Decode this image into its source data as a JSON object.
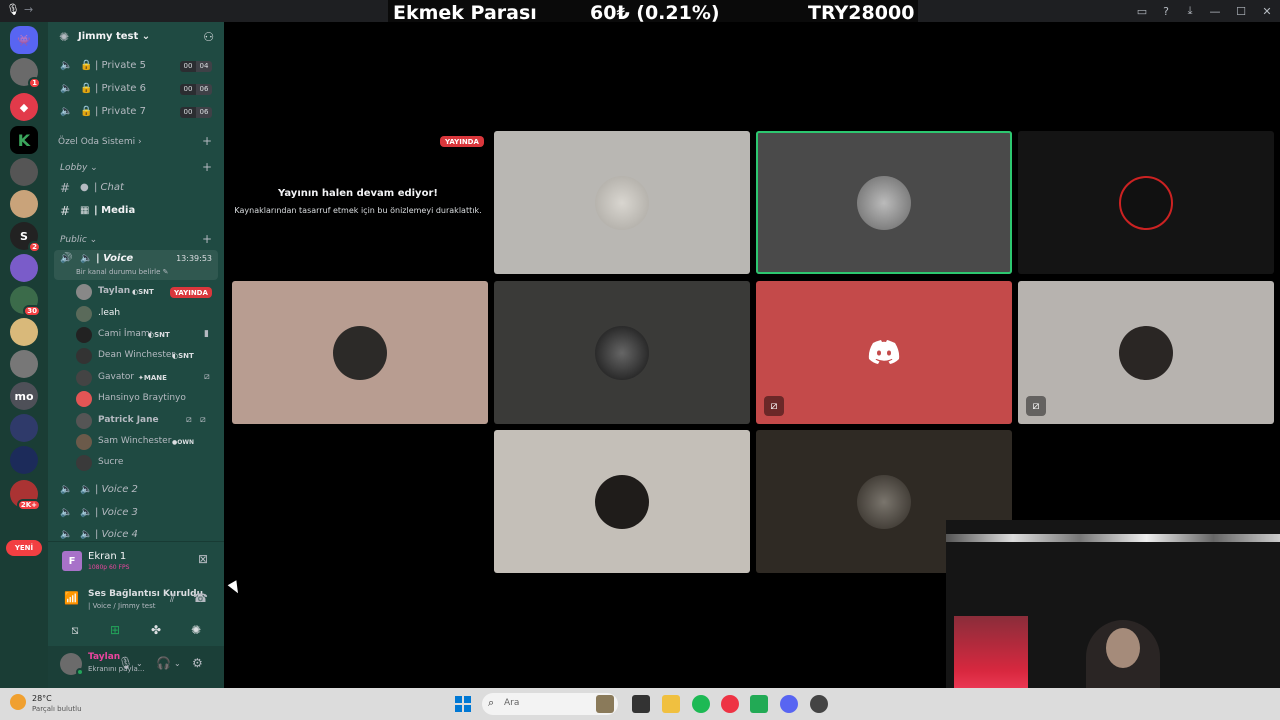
{
  "ticker": {
    "name": "Ekmek Parası",
    "change": "60₺ (0.21%)",
    "total": "TRY28000"
  },
  "guilds": {
    "badge_1": "1",
    "badge_2": "2",
    "badge_30": "30",
    "label_mo": "mo",
    "badge_2k": "2K+",
    "new_label": "YENİ"
  },
  "server": {
    "name": "Jimmy test"
  },
  "channels": {
    "private5": "| Private 5",
    "private6": "| Private 6",
    "private7": "| Private 7",
    "p5_counts": [
      "00",
      "04"
    ],
    "p6_counts": [
      "00",
      "06"
    ],
    "p7_counts": [
      "00",
      "06"
    ],
    "cat_ozel": "Özel Oda Sistemi",
    "cat_lobby": "Lobby",
    "chat": "| Chat",
    "media": "| Media",
    "cat_public": "Public",
    "voice": "| Voice",
    "voice_time": "13:39:53",
    "voice_status": "Bir kanal durumu belirle",
    "voice2": "| Voice 2",
    "voice3": "| Voice 3",
    "voice4": "| Voice 4"
  },
  "members": [
    {
      "name": "Taylan",
      "tag": "SNT",
      "live": "YAYINDA"
    },
    {
      "name": ".leah",
      "tag": "",
      "live": ""
    },
    {
      "name": "Cami İmamı",
      "tag": "SNT",
      "live": ""
    },
    {
      "name": "Dean Winchester",
      "tag": "SNT",
      "live": ""
    },
    {
      "name": "Gavator",
      "tag": "MANE",
      "live": ""
    },
    {
      "name": "Hansinyo Braytinyo",
      "tag": "",
      "live": ""
    },
    {
      "name": "Patrick Jane",
      "tag": "",
      "live": ""
    },
    {
      "name": "Sam Winchester",
      "tag": "OWN",
      "live": ""
    },
    {
      "name": "Sucre",
      "tag": "",
      "live": ""
    }
  ],
  "stream_panel": {
    "title": "Ekran 1",
    "quality": "1080p 60 FPS",
    "avatar_letter": "F"
  },
  "connection": {
    "title": "Ses Bağlantısı Kuruldu",
    "subtitle": "| Voice / Jimmy test"
  },
  "user": {
    "name": "Taylan",
    "status": "Ekranını payla..."
  },
  "stage": {
    "live_badge": "YAYINDA",
    "title": "Yayının halen devam ediyor!",
    "subtitle": "Kaynaklarından tasarruf etmek için bu önizlemeyi duraklattık."
  },
  "taskbar": {
    "temp": "28°C",
    "weather": "Parçalı bulutlu",
    "weather_badge": "1",
    "search_placeholder": "Ara"
  },
  "colors": {
    "accent_live": "#da373c",
    "speaking": "#2dc770",
    "discord_red_tile": "#c44a4a"
  }
}
